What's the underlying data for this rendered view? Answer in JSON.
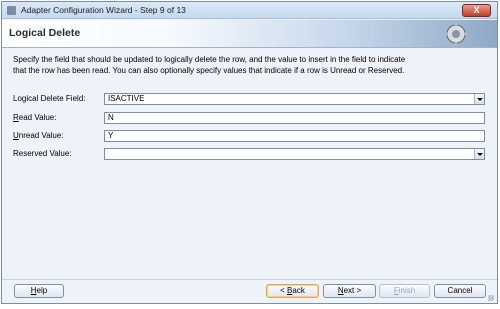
{
  "window": {
    "title": "Adapter Configuration Wizard - Step 9 of 13",
    "close_label": "X"
  },
  "header": {
    "title": "Logical Delete"
  },
  "description": {
    "line1": "Specify the field that should be updated to logically delete the row, and the value to insert in the field to indicate",
    "line2": "that the row has been read.  You can also optionally specify values that indicate if a row is Unread or Reserved."
  },
  "form": {
    "logical_delete_field": {
      "label_pre": "Logical Delete Field:",
      "value": "ISACTIVE"
    },
    "read_value": {
      "label_underlined": "R",
      "label_rest": "ead Value:",
      "value": "N"
    },
    "unread_value": {
      "label_underlined": "U",
      "label_rest": "nread Value:",
      "value": "Y"
    },
    "reserved_value": {
      "label_pre": "Reserved Value:",
      "value": ""
    }
  },
  "buttons": {
    "help": {
      "underlined": "H",
      "rest": "elp"
    },
    "back": {
      "prefix": "< ",
      "underlined": "B",
      "rest": "ack"
    },
    "next": {
      "underlined": "N",
      "rest": "ext >"
    },
    "finish": {
      "underlined": "F",
      "rest": "inish"
    },
    "cancel": {
      "label": "Cancel"
    }
  }
}
